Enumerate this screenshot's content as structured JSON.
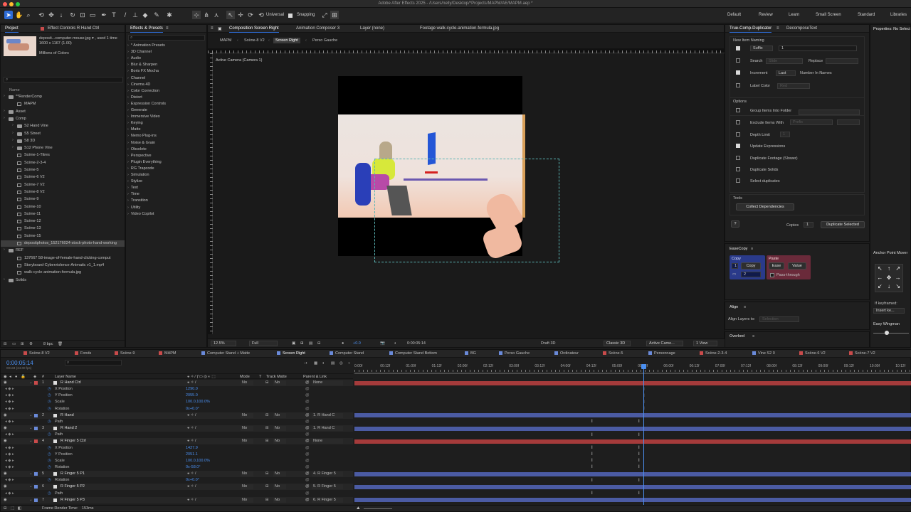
{
  "window": {
    "title": "Adobe After Effects 2025 - /Users/nelly/Desktop/*Projects/MAPM/AE/MAPM.aep *"
  },
  "toolbar": {
    "universal_label": "Universal",
    "snapping_label": "Snapping",
    "workspaces": [
      "Default",
      "Review",
      "Learn",
      "Small Screen",
      "Standard",
      "Libraries"
    ]
  },
  "project": {
    "tabs": [
      "Project",
      "Effect Controls R Hand Ctrl"
    ],
    "thumb_line1": "deposit...computer-mouse.jpg ▾ , used 1 time",
    "thumb_line2": "1600 x 1167 (1.00)",
    "thumb_line3": "Millions of Colors",
    "search_placeholder": "",
    "name_header": "Name",
    "items": [
      {
        "label": "**RenderComp",
        "type": "folder",
        "indent": 0
      },
      {
        "label": "MAPM",
        "type": "comp",
        "indent": 1
      },
      {
        "label": "Asset",
        "type": "folder",
        "indent": 0
      },
      {
        "label": "Comp",
        "type": "folder",
        "indent": 0
      },
      {
        "label": "S2 Hand Vine",
        "type": "folder",
        "indent": 1
      },
      {
        "label": "S5 Street",
        "type": "folder",
        "indent": 1
      },
      {
        "label": "S8 3D",
        "type": "folder",
        "indent": 1
      },
      {
        "label": "S12 Phone Vine",
        "type": "folder",
        "indent": 1
      },
      {
        "label": "Scène-1-Titres",
        "type": "comp",
        "indent": 1
      },
      {
        "label": "Scène-2-3-4",
        "type": "comp",
        "indent": 1
      },
      {
        "label": "Scène-5",
        "type": "comp",
        "indent": 1
      },
      {
        "label": "Scène-6 V2",
        "type": "comp",
        "indent": 1
      },
      {
        "label": "Scène-7 V2",
        "type": "comp",
        "indent": 1
      },
      {
        "label": "Scène-8 V2",
        "type": "comp",
        "indent": 1
      },
      {
        "label": "Scène-9",
        "type": "comp",
        "indent": 1
      },
      {
        "label": "Scène-10",
        "type": "comp",
        "indent": 1
      },
      {
        "label": "Scène-11",
        "type": "comp",
        "indent": 1
      },
      {
        "label": "Scène-12",
        "type": "comp",
        "indent": 1
      },
      {
        "label": "Scène-13",
        "type": "comp",
        "indent": 1
      },
      {
        "label": "Scène-15",
        "type": "comp",
        "indent": 1
      },
      {
        "label": "depositphotos_152176024-stock-photo-hand-working",
        "type": "file",
        "indent": 1,
        "selected": true
      },
      {
        "label": "REF",
        "type": "folder",
        "indent": 0
      },
      {
        "label": "137667 58-image-of-female-hand-clicking-comput",
        "type": "file",
        "indent": 1
      },
      {
        "label": "Storyboard-Cyberviolence-Animatic v1_1.mp4",
        "type": "file",
        "indent": 1
      },
      {
        "label": "walk-cycle-animation-formula.jpg",
        "type": "file",
        "indent": 1
      },
      {
        "label": "Solids",
        "type": "folder",
        "indent": 0
      }
    ],
    "bpc": "8 bpc"
  },
  "effects": {
    "tab": "Effects & Presets",
    "items": [
      "* Animation Presets",
      "3D Channel",
      "Audio",
      "Blur & Sharpen",
      "Boris FX Mocha",
      "Channel",
      "Cinema 4D",
      "Color Correction",
      "Distort",
      "Expression Controls",
      "Generate",
      "Immersive Video",
      "Keying",
      "Matte",
      "Nemo Plug-ins",
      "Noise & Grain",
      "Obsolete",
      "Perspective",
      "Plugin Everything",
      "RG Trapcode",
      "Simulation",
      "Stylize",
      "Text",
      "Time",
      "Transition",
      "Utility",
      "Video Copilot"
    ]
  },
  "viewer": {
    "tabs": [
      "Composition Screen Right",
      "Animation Composer 3",
      "Layer (none)",
      "Footage walk-cycle-animation-formula.jpg"
    ],
    "breadcrumbs": [
      "MAPM",
      "Scène-8 V2",
      "Screen Right",
      "Perso Gauche"
    ],
    "camera_label": "Active Camera (Camera 1)",
    "zoom": "12.5%",
    "resolution": "Full",
    "timecode": "0:00:05:14",
    "renderer": "Draft 3D",
    "classic": "Classic 3D",
    "camera": "Active Came...",
    "views": "1 View",
    "exposure": "+0.0"
  },
  "truecomp": {
    "tabs": [
      "True-Comp-Duplicator",
      "DecomposeText"
    ],
    "section_new_item": "New Item Naming",
    "suffix_label": "Suffix",
    "suffix_value": "1",
    "search_label": "Search",
    "search_value": "Slide",
    "replace_label": "Replace",
    "increment_label": "Increment",
    "increment_value": "Last",
    "number_in_names": "Number In Names",
    "label_color": "Label Color",
    "label_color_value": "Red",
    "options_title": "Options",
    "options": [
      {
        "label": "Group Items Into Folder",
        "checked": false
      },
      {
        "label": "Exclude Items With",
        "checked": false
      },
      {
        "label": "Depth Limit",
        "checked": false
      },
      {
        "label": "Update Expressions",
        "checked": true
      },
      {
        "label": "Duplicate Footage (Slower)",
        "checked": false
      },
      {
        "label": "Duplicate Solids",
        "checked": false
      },
      {
        "label": "Select duplicates",
        "checked": false
      }
    ],
    "exclude_value": "Prefix",
    "depth_value": "1",
    "tools_title": "Tools",
    "collect_btn": "Collect Dependencies",
    "help": "?",
    "copies_label": "Copies",
    "copies_value": "1",
    "duplicate_btn": "Duplicate Selected"
  },
  "easecopy": {
    "title": "EaseCopy",
    "copy_title": "Copy",
    "copy_btn": "Copy",
    "copy_field": "1",
    "copy_count": "2",
    "paste_title": "Paste",
    "ease_btn": "Ease",
    "value_btn": "Value",
    "passthrough": "Pass-through"
  },
  "align": {
    "title": "Align",
    "label": "Align Layers to:",
    "value": "Selection"
  },
  "overlord": {
    "title": "Overlord"
  },
  "properties": {
    "title": "Properties: No Select",
    "anchor_title": "Anchor Point Mover",
    "ifkey_label": "If keyframed:",
    "ifkey_value": "Insert ke...",
    "easy_wingman": "Easy Wingman"
  },
  "timeline": {
    "tabs": [
      "Scène-8 V2",
      "Fonds",
      "Scène-9",
      "MAPM",
      "Computer Stand + Matte",
      "Screen Right",
      "Computer Stand",
      "Computer Stand Bottom",
      "BG",
      "Perso Gauche",
      "Ordinateur",
      "Scène-5",
      "Personnage",
      "Scène-2-3-4",
      "Vine S2 0",
      "Scène-6 V2",
      "Scène-7 V2"
    ],
    "tab_colors": [
      "#c94b4b",
      "#c94b4b",
      "#c94b4b",
      "#c94b4b",
      "#6a8ad9",
      "#6a8ad9",
      "#6a8ad9",
      "#6a8ad9",
      "#6a8ad9",
      "#6a8ad9",
      "#6a8ad9",
      "#c94b4b",
      "#6a8ad9",
      "#c94b4b",
      "#6a8ad9",
      "#c94b4b",
      "#c94b4b"
    ],
    "timecode": "0:00:05:14",
    "timecode_sub": "00134 (24.00 fps)",
    "headers": {
      "name": "Layer Name",
      "mode": "Mode",
      "t": "T",
      "trackmatte": "Track Matte",
      "parent": "Parent & Link"
    },
    "ruler": [
      "0:00f",
      "00:12f",
      "01:00f",
      "01:12f",
      "02:00f",
      "02:12f",
      "03:00f",
      "03:12f",
      "04:00f",
      "04:12f",
      "05:00f",
      "05:12f",
      "06:00f",
      "06:12f",
      "07:00f",
      "07:12f",
      "08:00f",
      "08:12f",
      "09:00f",
      "09:12f",
      "10:00f",
      "10:12f"
    ],
    "rows": [
      {
        "type": "layer",
        "num": "1",
        "name": "R Hand Ctrl",
        "color": "#c94b4b",
        "mode": "No",
        "track": "No",
        "parent": "None",
        "bar": "#a53b3b"
      },
      {
        "type": "prop",
        "name": "X Position",
        "value": "1290.0"
      },
      {
        "type": "prop",
        "name": "Y Position",
        "value": "2055.0"
      },
      {
        "type": "prop",
        "name": "Scale",
        "value": "100.0,100.0%"
      },
      {
        "type": "prop",
        "name": "Rotation",
        "value": "0x+0.0°"
      },
      {
        "type": "layer",
        "num": "2",
        "name": "R Hand",
        "color": "#6a8ad9",
        "mode": "No",
        "track": "No",
        "parent": "1. R Hand C",
        "bar": "#4b5ba3"
      },
      {
        "type": "prop",
        "name": "Path",
        "value": ""
      },
      {
        "type": "layer",
        "num": "3",
        "name": "R Hand 2",
        "color": "#6a8ad9",
        "mode": "No",
        "track": "No",
        "parent": "1. R Hand C",
        "bar": "#4b5ba3"
      },
      {
        "type": "prop",
        "name": "Path",
        "value": ""
      },
      {
        "type": "layer",
        "num": "4",
        "name": "R Finger 5 Ctrl",
        "color": "#c94b4b",
        "mode": "No",
        "track": "No",
        "parent": "None",
        "bar": "#a53b3b"
      },
      {
        "type": "prop",
        "name": "X Position",
        "value": "1427.9"
      },
      {
        "type": "prop",
        "name": "Y Position",
        "value": "2051.1"
      },
      {
        "type": "prop",
        "name": "Scale",
        "value": "100.0,100.0%"
      },
      {
        "type": "prop",
        "name": "Rotation",
        "value": "0x-58.0°"
      },
      {
        "type": "layer",
        "num": "5",
        "name": "R Finger 5 P1",
        "color": "#6a8ad9",
        "mode": "No",
        "track": "No",
        "parent": "4. R Finger 5",
        "bar": "#4b5ba3"
      },
      {
        "type": "prop",
        "name": "Rotation",
        "value": "0x+0.0°"
      },
      {
        "type": "layer",
        "num": "6",
        "name": "R Finger 5 P2",
        "color": "#6a8ad9",
        "mode": "No",
        "track": "No",
        "parent": "5. R Finger 5",
        "bar": "#4b5ba3"
      },
      {
        "type": "prop",
        "name": "Path",
        "value": ""
      },
      {
        "type": "layer",
        "num": "7",
        "name": "R Finger 5 P3",
        "color": "#6a8ad9",
        "mode": "No",
        "track": "No",
        "parent": "6. R Finger 5",
        "bar": "#4b5ba3"
      }
    ],
    "frame_render": "Frame Render Time:",
    "frame_render_value": "153ms"
  }
}
